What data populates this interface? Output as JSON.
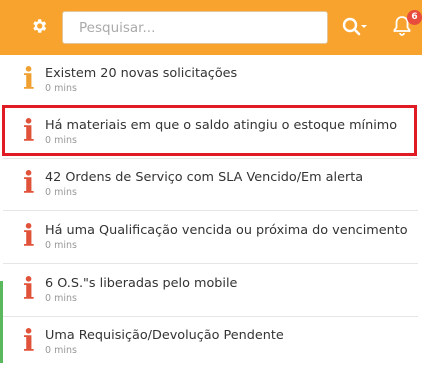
{
  "topbar": {
    "search_placeholder": "Pesquisar...",
    "settings_icon": "gear-icon",
    "search_icon": "search-icon",
    "bell_icon": "bell-icon",
    "notification_count": "6",
    "accent_color": "#f7a32e"
  },
  "notifications": [
    {
      "title": "Existem 20 novas solicitações",
      "time": "0 mins",
      "icon": "info-icon",
      "icon_color": "#f0a030"
    },
    {
      "title": "Há materiais em que o saldo atingiu o estoque mínimo",
      "time": "0 mins",
      "icon": "info-icon",
      "icon_color": "#e0533a"
    },
    {
      "title": "42 Ordens de Serviço com SLA Vencido/Em alerta",
      "time": "0 mins",
      "icon": "info-icon",
      "icon_color": "#e0533a"
    },
    {
      "title": "Há uma Qualificação vencida ou próxima do vencimento",
      "time": "0 mins",
      "icon": "info-icon",
      "icon_color": "#e0533a"
    },
    {
      "title": "6 O.S.\"s liberadas pelo mobile",
      "time": "0 mins",
      "icon": "info-icon",
      "icon_color": "#e0533a"
    },
    {
      "title": "Uma Requisição/Devolução Pendente",
      "time": "0 mins",
      "icon": "info-icon",
      "icon_color": "#e0533a"
    }
  ]
}
